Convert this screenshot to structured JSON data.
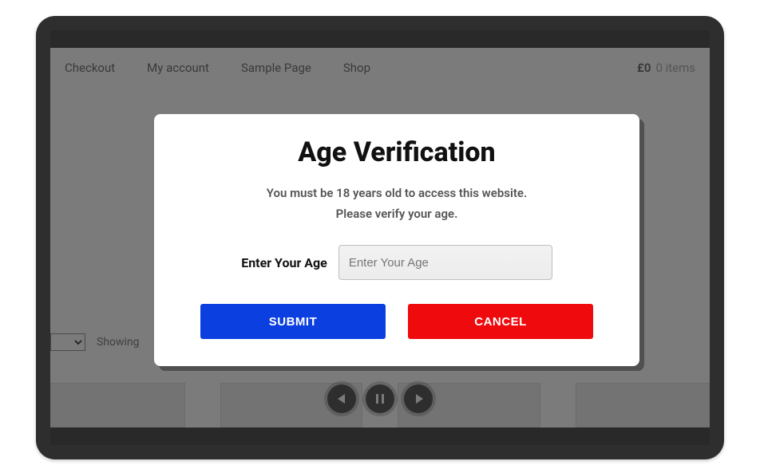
{
  "nav": {
    "items": [
      "Checkout",
      "My account",
      "Sample Page",
      "Shop"
    ],
    "cart_total": "£0",
    "cart_items": "0 items"
  },
  "listing": {
    "showing_label": "Showing"
  },
  "modal": {
    "title": "Age Verification",
    "line1": "You must be 18 years old to access this website.",
    "line2": "Please verify your age.",
    "field_label": "Enter Your Age",
    "input_placeholder": "Enter Your Age",
    "submit_label": "SUBMIT",
    "cancel_label": "CANCEL"
  }
}
